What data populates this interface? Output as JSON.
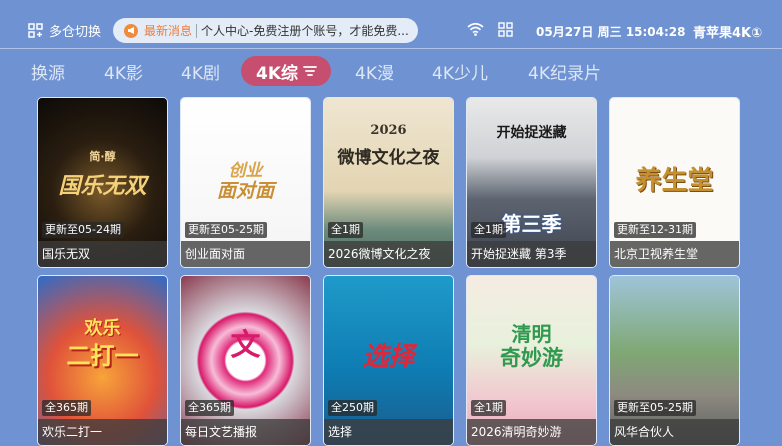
{
  "header": {
    "switch_label": "多仓切换",
    "news_tag": "最新消息",
    "news_text": "个人中心-免费注册个账号，才能免费...",
    "datetime": "05月27日 周三 15:04:28",
    "brand": "青苹果4K①"
  },
  "tabs": [
    {
      "label": "换源",
      "active": false
    },
    {
      "label": "4K影",
      "active": false
    },
    {
      "label": "4K剧",
      "active": false
    },
    {
      "label": "4K综",
      "active": true
    },
    {
      "label": "4K漫",
      "active": false
    },
    {
      "label": "4K少儿",
      "active": false
    },
    {
      "label": "4K纪录片",
      "active": false
    }
  ],
  "cards": [
    {
      "title": "国乐无双",
      "badge": "更新至05-24期",
      "poster_text": "国乐无双",
      "poster_sub": "简·醇"
    },
    {
      "title": "创业面对面",
      "badge": "更新至05-25期",
      "poster_text": "面对面",
      "poster_sub": "创业"
    },
    {
      "title": "2026微博文化之夜",
      "badge": "全1期",
      "poster_text": "微博文化之夜",
      "poster_sub": "2026"
    },
    {
      "title": "开始捉迷藏 第3季",
      "badge": "全1期",
      "poster_text": "第三季",
      "poster_sub": "开始捉迷藏"
    },
    {
      "title": "北京卫视养生堂",
      "badge": "更新至12-31期",
      "poster_text": "养生堂",
      "poster_sub": ""
    },
    {
      "title": "欢乐二打一",
      "badge": "全365期",
      "poster_text": "二打一",
      "poster_sub": "欢乐"
    },
    {
      "title": "每日文艺播报",
      "badge": "全365期",
      "poster_text": "文",
      "poster_sub": ""
    },
    {
      "title": "选择",
      "badge": "全250期",
      "poster_text": "选择",
      "poster_sub": ""
    },
    {
      "title": "2026清明奇妙游",
      "badge": "全1期",
      "poster_text": "奇妙游",
      "poster_sub": "清明"
    },
    {
      "title": "风华合伙人",
      "badge": "更新至05-25期",
      "poster_text": "",
      "poster_sub": ""
    }
  ],
  "colors": {
    "background": "#6f93d2",
    "active_tab": "#c64f6f",
    "news_tag": "#f07b3a"
  }
}
